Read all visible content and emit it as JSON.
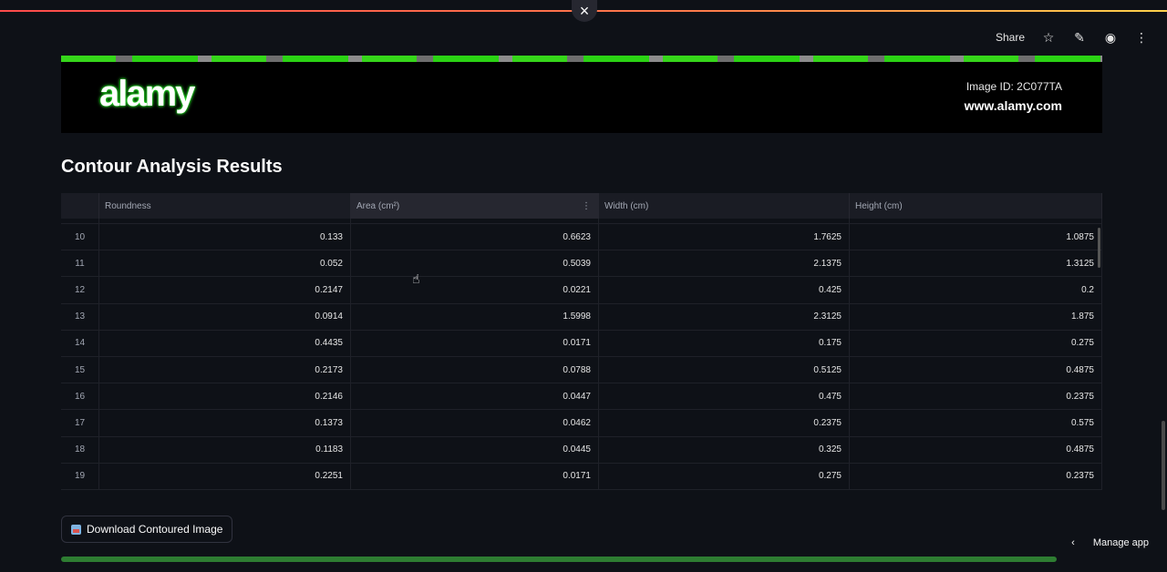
{
  "header": {
    "close_icon": "×",
    "share_label": "Share",
    "star_icon": "☆",
    "edit_icon": "✎",
    "github_icon": "◉",
    "menu_icon": "⋮"
  },
  "banner": {
    "logo_text": "alamy",
    "image_id": "Image ID: 2C077TA",
    "site": "www.alamy.com"
  },
  "page_title": "Contour Analysis Results",
  "table": {
    "columns": [
      "Roundness",
      "Area (cm²)",
      "Width (cm)",
      "Height (cm)"
    ],
    "rows": [
      {
        "idx": "10",
        "roundness": "0.133",
        "area": "0.6623",
        "width": "1.7625",
        "height": "1.0875"
      },
      {
        "idx": "11",
        "roundness": "0.052",
        "area": "0.5039",
        "width": "2.1375",
        "height": "1.3125"
      },
      {
        "idx": "12",
        "roundness": "0.2147",
        "area": "0.0221",
        "width": "0.425",
        "height": "0.2"
      },
      {
        "idx": "13",
        "roundness": "0.0914",
        "area": "1.5998",
        "width": "2.3125",
        "height": "1.875"
      },
      {
        "idx": "14",
        "roundness": "0.4435",
        "area": "0.0171",
        "width": "0.175",
        "height": "0.275"
      },
      {
        "idx": "15",
        "roundness": "0.2173",
        "area": "0.0788",
        "width": "0.5125",
        "height": "0.4875"
      },
      {
        "idx": "16",
        "roundness": "0.2146",
        "area": "0.0447",
        "width": "0.475",
        "height": "0.2375"
      },
      {
        "idx": "17",
        "roundness": "0.1373",
        "area": "0.0462",
        "width": "0.2375",
        "height": "0.575"
      },
      {
        "idx": "18",
        "roundness": "0.1183",
        "area": "0.0445",
        "width": "0.325",
        "height": "0.4875"
      },
      {
        "idx": "19",
        "roundness": "0.2251",
        "area": "0.0171",
        "width": "0.275",
        "height": "0.2375"
      }
    ]
  },
  "download_button": "Download Contoured Image",
  "manage_app": "Manage app",
  "chevron_icon": "‹"
}
